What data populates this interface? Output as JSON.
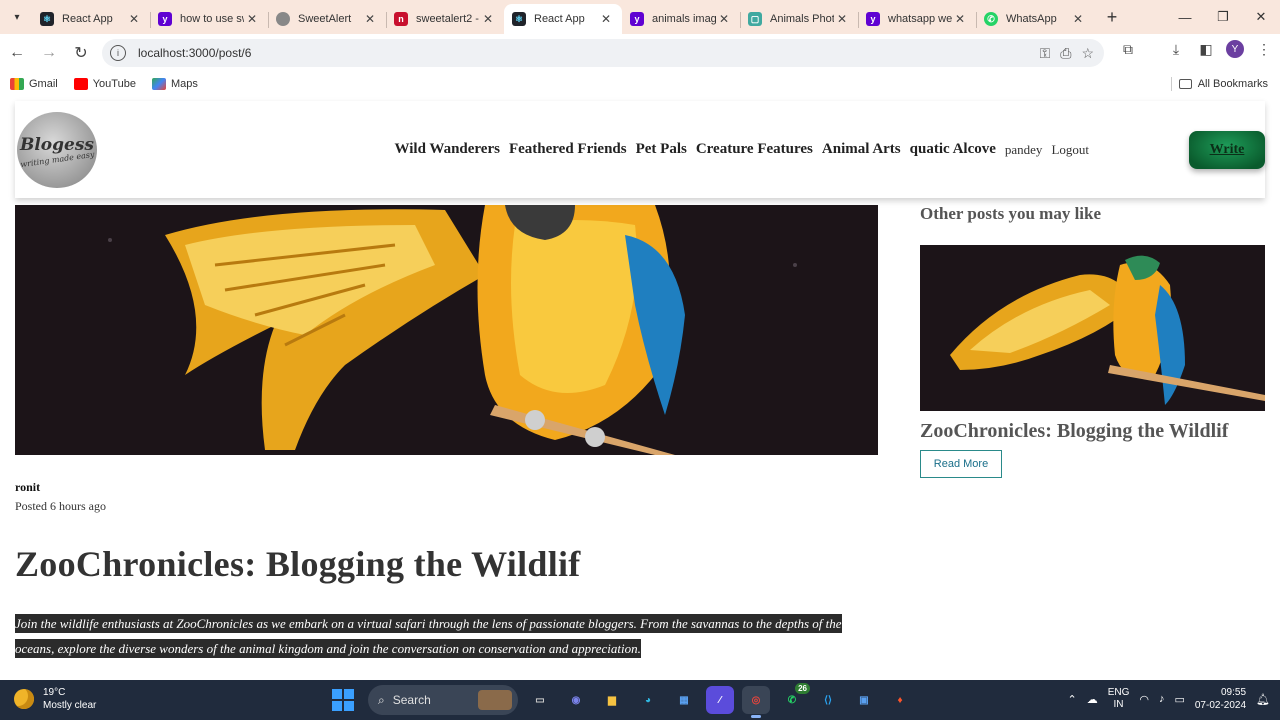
{
  "browser": {
    "tabs": [
      {
        "title": "React App",
        "favicon": "react-icon",
        "active": false
      },
      {
        "title": "how to use sw",
        "favicon": "yahoo-icon",
        "active": false
      },
      {
        "title": "SweetAlert",
        "favicon": "globe-icon",
        "active": false
      },
      {
        "title": "sweetalert2 -",
        "favicon": "npm-icon",
        "active": false
      },
      {
        "title": "React App",
        "favicon": "react-icon",
        "active": true
      },
      {
        "title": "animals imag",
        "favicon": "yahoo-icon",
        "active": false
      },
      {
        "title": "Animals Phot",
        "favicon": "photo-icon",
        "active": false
      },
      {
        "title": "whatsapp we",
        "favicon": "yahoo-icon",
        "active": false
      },
      {
        "title": "WhatsApp",
        "favicon": "whatsapp-icon",
        "active": false
      }
    ],
    "url": "localhost:3000/post/6",
    "profile_initial": "Y",
    "bookmarks": [
      {
        "label": "Gmail"
      },
      {
        "label": "YouTube"
      },
      {
        "label": "Maps"
      }
    ],
    "all_bookmarks_label": "All Bookmarks"
  },
  "site": {
    "logo_name": "Blogess",
    "logo_tagline": "writing made easy",
    "categories": [
      "Wild Wanderers",
      "Feathered Friends",
      "Pet Pals",
      "Creature Features",
      "Animal Arts",
      "quatic Alcove"
    ],
    "username": "pandey",
    "logout_label": "Logout",
    "write_label": "Write"
  },
  "post": {
    "author": "ronit",
    "posted": "Posted 6 hours ago",
    "title": "ZooChronicles: Blogging the Wildlif",
    "description": "Join the wildlife enthusiasts at ZooChronicles as we embark on a virtual safari through the lens of passionate bloggers. From the savannas to the depths of the oceans, explore the diverse wonders of the animal kingdom and join the conversation on conservation and appreciation."
  },
  "sidebar": {
    "heading": "Other posts you may like",
    "post_title": "ZooChronicles: Blogging the Wildlif",
    "read_more_label": "Read More"
  },
  "taskbar": {
    "temperature": "19°C",
    "weather": "Mostly clear",
    "search_placeholder": "Search",
    "whatsapp_badge": "26",
    "lang_top": "ENG",
    "lang_bottom": "IN",
    "time": "09:55",
    "date": "07-02-2024"
  }
}
